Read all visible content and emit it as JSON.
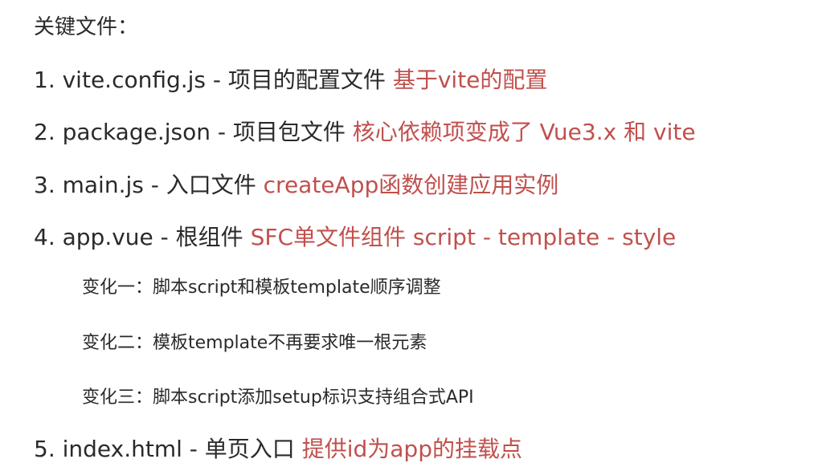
{
  "heading": "关键文件：",
  "accent_color": "#c0504d",
  "items": [
    {
      "text": "1. vite.config.js - 项目的配置文件",
      "highlight": "基于vite的配置"
    },
    {
      "text": "2. package.json - 项目包文件",
      "highlight": "核心依赖项变成了 Vue3.x 和 vite"
    },
    {
      "text": "3. main.js - 入口文件",
      "highlight": "createApp函数创建应用实例"
    },
    {
      "text": "4. app.vue - 根组件",
      "highlight": "SFC单文件组件 script - template - style"
    },
    {
      "text": "5. index.html - 单页入口",
      "highlight": "提供id为app的挂载点"
    }
  ],
  "changes": [
    "变化一：脚本script和模板template顺序调整",
    "变化二：模板template不再要求唯一根元素",
    "变化三：脚本script添加setup标识支持组合式API"
  ]
}
